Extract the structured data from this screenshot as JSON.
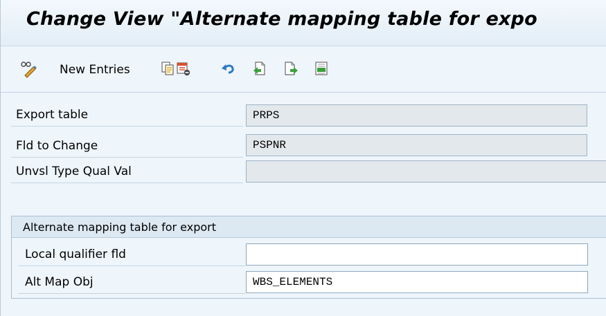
{
  "window": {
    "title": "Change View \"Alternate mapping table for expo"
  },
  "toolbar": {
    "new_entries_label": "New Entries",
    "icons": [
      "glasses-pencil-icon",
      "copy-icon",
      "delete-icon",
      "undo-icon",
      "previous-entry-icon",
      "next-entry-icon",
      "select-block-icon"
    ]
  },
  "header_fields": [
    {
      "label": "Export table",
      "value": "PRPS",
      "editable": false
    },
    {
      "label": "Fld to Change",
      "value": "PSPNR",
      "editable": false
    },
    {
      "label": "Unvsl Type Qual Val",
      "value": "",
      "editable": false
    }
  ],
  "group": {
    "title": "Alternate mapping table for export",
    "fields": [
      {
        "label": "Local qualifier fld",
        "value": "",
        "editable": true
      },
      {
        "label": "Alt Map Obj",
        "value": "WBS_ELEMENTS",
        "editable": true
      }
    ]
  },
  "colors": {
    "background": "#eef5fb",
    "readonly_field": "#e3e8ec",
    "editable_field": "#ffffff",
    "group_header": "#dce8f2"
  }
}
